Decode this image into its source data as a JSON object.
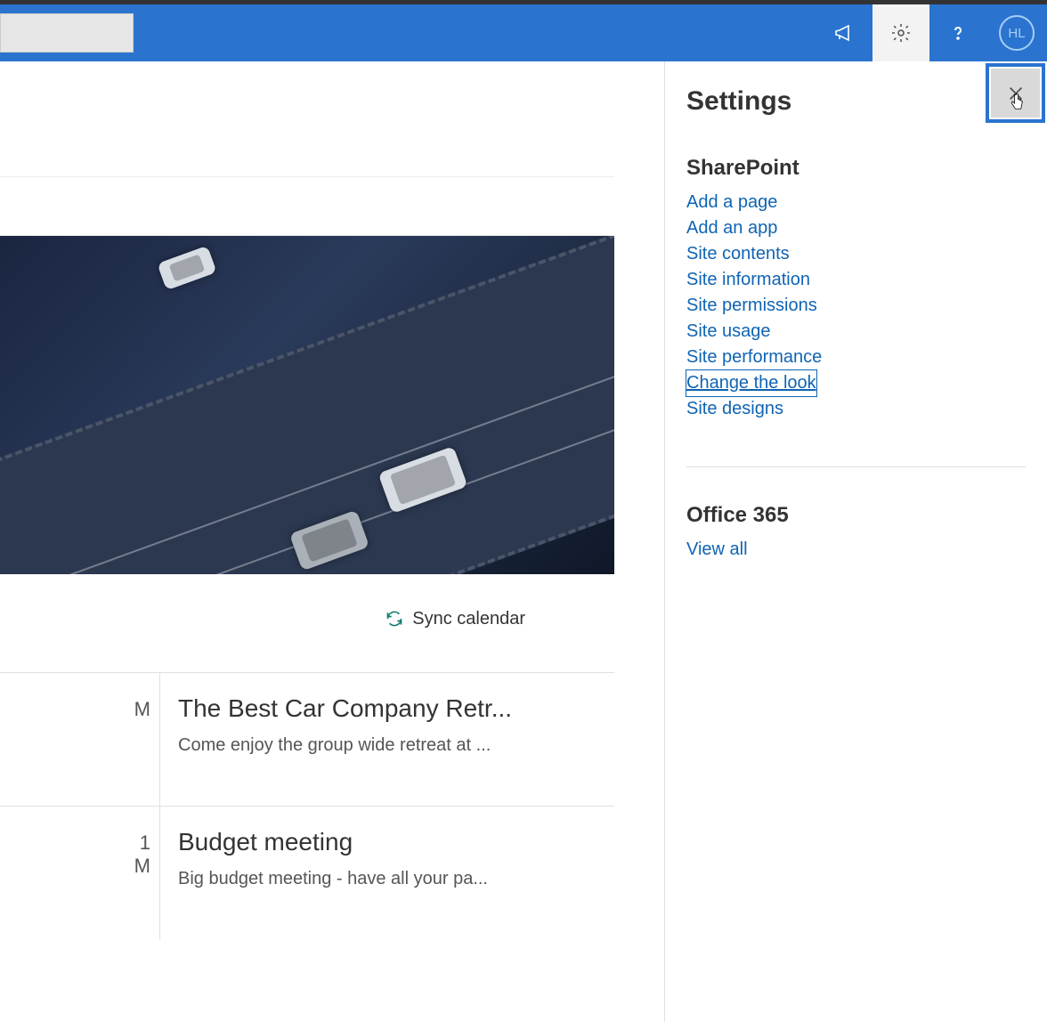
{
  "header": {
    "avatar_initials": "HL"
  },
  "main": {
    "sync_label": "Sync calendar",
    "events": [
      {
        "left_partial": "M",
        "title": "The Best Car Company Retr...",
        "desc": "Come enjoy the group wide retreat at ..."
      },
      {
        "left_partial_line1": "1",
        "left_partial_line2": "M",
        "title": "Budget meeting",
        "desc": "Big budget meeting - have all your pa..."
      }
    ]
  },
  "settings": {
    "title": "Settings",
    "sections": [
      {
        "heading": "SharePoint",
        "links": [
          "Add a page",
          "Add an app",
          "Site contents",
          "Site information",
          "Site permissions",
          "Site usage",
          "Site performance",
          "Change the look",
          "Site designs"
        ],
        "focused_index": 7
      },
      {
        "heading": "Office 365",
        "links": [
          "View all"
        ]
      }
    ]
  }
}
